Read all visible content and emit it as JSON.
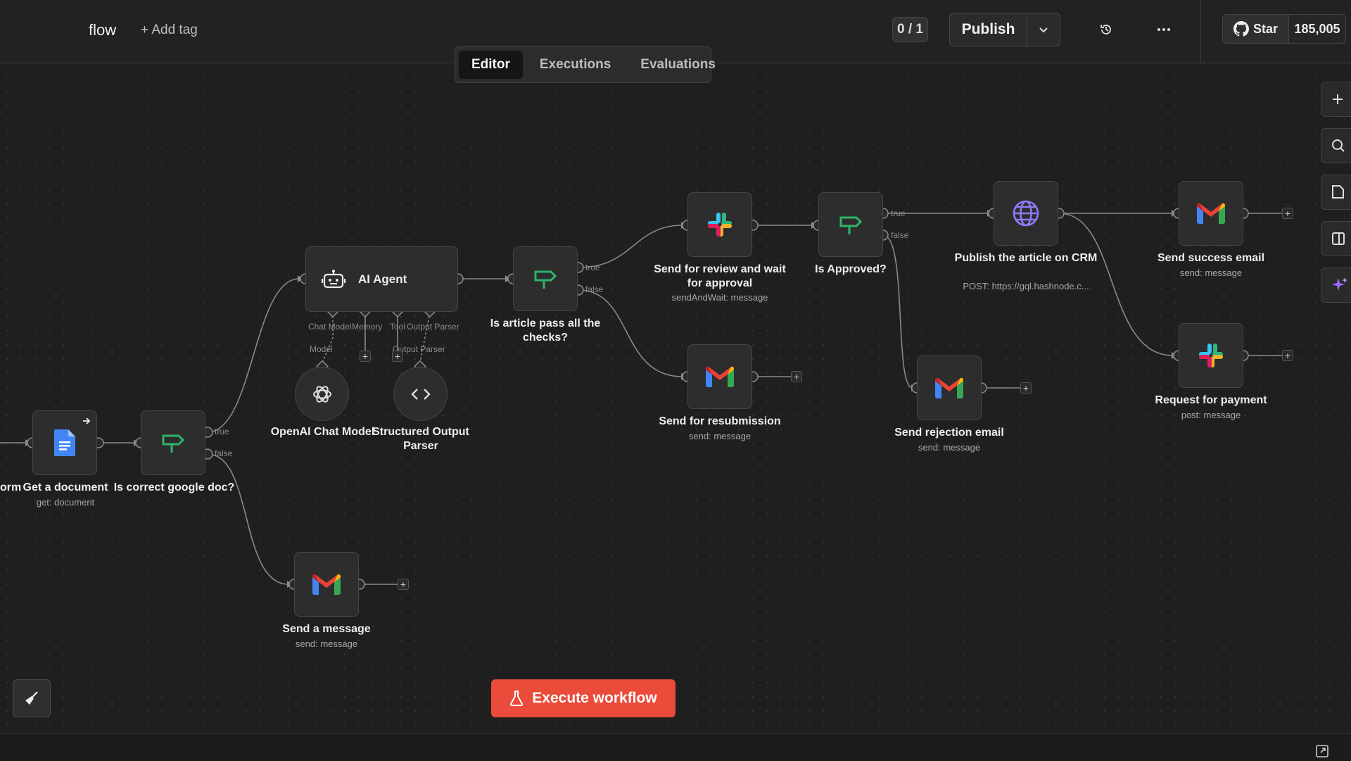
{
  "header": {
    "workflow_name": "flow",
    "add_tag": "+ Add tag",
    "version_counter": "0 / 1",
    "publish_label": "Publish",
    "github_star": "Star",
    "github_count": "185,005"
  },
  "tabs": [
    {
      "label": "Editor",
      "active": true
    },
    {
      "label": "Executions",
      "active": false
    },
    {
      "label": "Evaluations",
      "active": false
    }
  ],
  "nodes": {
    "trigger_partial": {
      "label": "orm"
    },
    "get_document": {
      "label": "Get a document",
      "subtitle": "get: document",
      "icon": "google-docs-icon"
    },
    "is_correct_doc": {
      "label": "Is correct google doc?",
      "icon": "if-icon"
    },
    "ai_agent": {
      "label": "AI Agent",
      "icon": "robot-icon"
    },
    "openai_model": {
      "label": "OpenAI Chat Model",
      "icon": "openai-icon"
    },
    "structured_parser": {
      "label": "Structured Output Parser",
      "icon": "code-icon"
    },
    "send_message": {
      "label": "Send a message",
      "subtitle": "send: message",
      "icon": "gmail-icon"
    },
    "is_article_pass": {
      "label": "Is article pass all the checks?",
      "icon": "if-icon"
    },
    "send_review": {
      "label": "Send for review and wait for approval",
      "subtitle": "sendAndWait: message",
      "icon": "slack-icon"
    },
    "send_resubmission": {
      "label": "Send for resubmission",
      "subtitle": "send: message",
      "icon": "gmail-icon"
    },
    "is_approved": {
      "label": "Is Approved?",
      "icon": "if-icon"
    },
    "send_rejection": {
      "label": "Send rejection email",
      "subtitle": "send: message",
      "icon": "gmail-icon"
    },
    "publish_article": {
      "label": "Publish the article on CRM",
      "subtitle": "POST: https://gql.hashnode.c...",
      "icon": "globe-icon"
    },
    "send_success": {
      "label": "Send success email",
      "subtitle": "send: message",
      "icon": "gmail-icon"
    },
    "request_payment": {
      "label": "Request for payment",
      "subtitle": "post: message",
      "icon": "slack-icon"
    }
  },
  "agent_ports": {
    "chat_model": "Chat Model",
    "model": "Model",
    "memory": "Memory",
    "tool": "Tool",
    "output_parser": "Output Parser",
    "output_parser_sub": "Output Parser"
  },
  "branch_labels": {
    "true": "true",
    "false": "false"
  },
  "execute_button": "Execute workflow",
  "colors": {
    "canvas": "#1f1f1f",
    "node_bg": "#2d2d2d",
    "execute": "#ea4b3a",
    "if_green": "#2fb36b",
    "globe_purple": "#8b7cf6"
  }
}
